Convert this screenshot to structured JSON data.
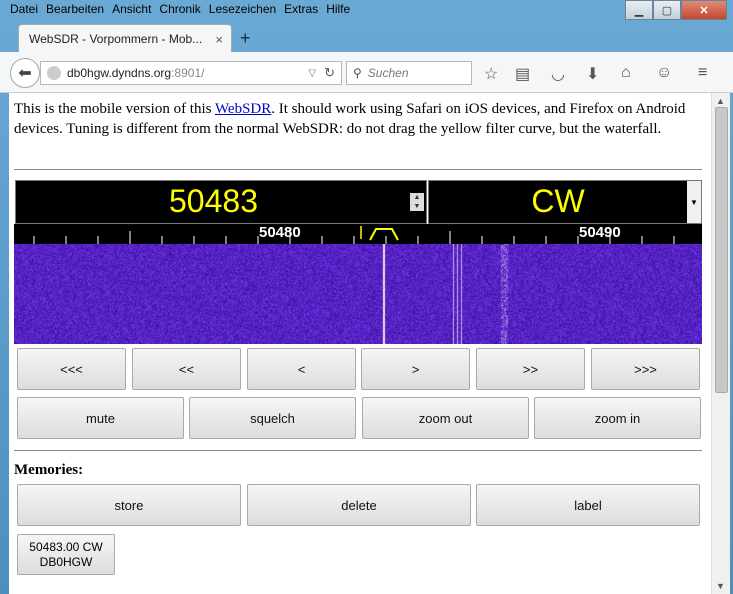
{
  "browser": {
    "menu": [
      "Datei",
      "Bearbeiten",
      "Ansicht",
      "Chronik",
      "Lesezeichen",
      "Extras",
      "Hilfe"
    ],
    "tab_title": "WebSDR - Vorpommern - Mob...",
    "tab_close": "×",
    "new_tab": "+",
    "url_host": "db0hgw.dyndns.org",
    "url_rest": ":8901/",
    "search_placeholder": "Suchen"
  },
  "page": {
    "intro_before": "This is the mobile version of this ",
    "intro_link": "WebSDR",
    "intro_after": ". It should work using Safari on iOS devices, and Firefox on Android devices. Tuning is different from the normal WebSDR: do not drag the yellow filter curve, but the waterfall.",
    "frequency": "50483",
    "mode": "CW",
    "scale_labels": [
      "50480",
      "50490"
    ],
    "tuning_buttons": [
      "<<<",
      "<<",
      "<",
      ">",
      ">>",
      ">>>"
    ],
    "control_buttons": [
      "mute",
      "squelch",
      "zoom out",
      "zoom in"
    ],
    "memories_heading": "Memories:",
    "memory_buttons": [
      "store",
      "delete",
      "label"
    ],
    "memory_entry_line1": "50483.00 CW",
    "memory_entry_line2": "DB0HGW"
  },
  "colors": {
    "display_text": "#ffff00",
    "waterfall": "#3a1a8a"
  }
}
